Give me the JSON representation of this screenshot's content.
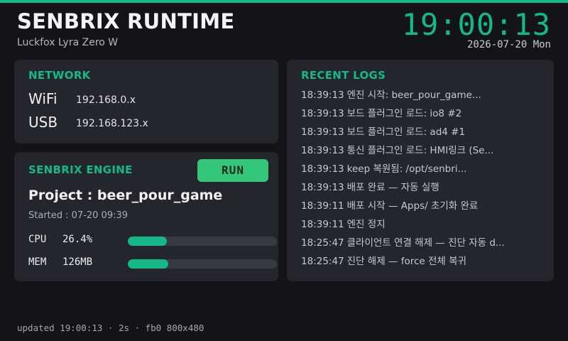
{
  "colors": {
    "accent": "#14b88c",
    "run_button": "#34c77b",
    "background": "#131417",
    "card": "#23262c"
  },
  "header": {
    "title": "SENBRIX RUNTIME",
    "subtitle": "Luckfox Lyra Zero W",
    "clock": "19:00:13",
    "date": "2026-07-20 Mon"
  },
  "network": {
    "title": "NETWORK",
    "items": [
      {
        "label": "WiFi",
        "value": "192.168.0.x"
      },
      {
        "label": "USB",
        "value": "192.168.123.x"
      }
    ]
  },
  "engine": {
    "title": "SENBRIX ENGINE",
    "run_label": "RUN",
    "project": "Project : beer_pour_game",
    "started": "Started : 07-20 09:39",
    "cpu": {
      "label": "CPU",
      "value": "26.4%",
      "fraction": 0.264
    },
    "mem": {
      "label": "MEM",
      "value": "126MB",
      "fraction": 0.27
    }
  },
  "logs": {
    "title": "RECENT LOGS",
    "items": [
      {
        "time": "18:39:13",
        "text": "엔진 시작: beer_pour_game..."
      },
      {
        "time": "18:39:13",
        "text": "보드 플러그인 로드: io8 #2"
      },
      {
        "time": "18:39:13",
        "text": "보드 플러그인 로드: ad4 #1"
      },
      {
        "time": "18:39:13",
        "text": "통신 플러그인 로드: HMI링크 (Se..."
      },
      {
        "time": "18:39:13",
        "text": "keep 복원됨: /opt/senbri..."
      },
      {
        "time": "18:39:13",
        "text": "배포 완료 — 자동 실행"
      },
      {
        "time": "18:39:11",
        "text": "배포 시작 — Apps/ 초기화 완료"
      },
      {
        "time": "18:39:11",
        "text": "엔진 정지"
      },
      {
        "time": "18:25:47",
        "text": "클라이언트 연결 해제 — 진단 자동 d..."
      },
      {
        "time": "18:25:47",
        "text": "진단 해제 — force 전체 복귀"
      }
    ]
  },
  "footer": {
    "text": "updated 19:00:13 · 2s · fb0 800x480"
  }
}
